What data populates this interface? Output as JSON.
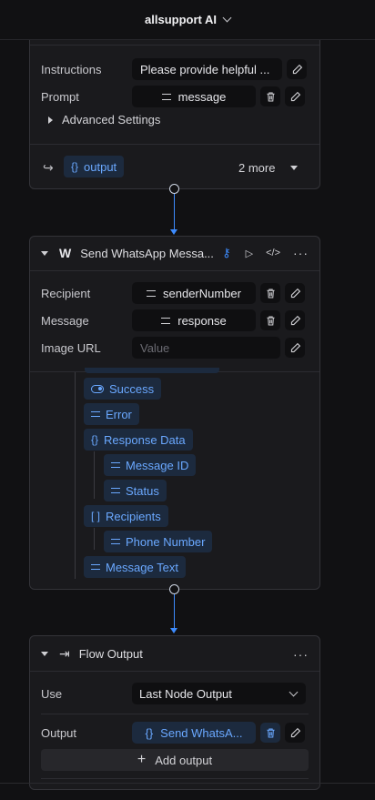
{
  "app": {
    "title": "allsupport AI"
  },
  "prev_node": {
    "instructions_label": "Instructions",
    "instructions_value": "Please provide helpful ...",
    "prompt_label": "Prompt",
    "prompt_value": "message",
    "advanced_label": "Advanced Settings",
    "output_chip": "output",
    "more_label": "2 more"
  },
  "whatsapp_node": {
    "title": "Send WhatsApp Messa...",
    "recipient_label": "Recipient",
    "recipient_value": "senderNumber",
    "message_label": "Message",
    "message_value": "response",
    "image_label": "Image URL",
    "image_placeholder": "Value",
    "outputs": {
      "success": "Success",
      "error": "Error",
      "response_data": "Response Data",
      "message_id": "Message ID",
      "status": "Status",
      "recipients": "Recipients",
      "phone_number": "Phone Number",
      "message_text": "Message Text"
    }
  },
  "flow_output": {
    "title": "Flow Output",
    "use_label": "Use",
    "use_value": "Last Node Output",
    "output_label": "Output",
    "output_value": "Send WhatsA...",
    "add_output": "Add output"
  },
  "colors": {
    "accent": "#3d8bfd",
    "chip_bg": "#1c2a3e",
    "chip_text": "#6aa8ff"
  }
}
